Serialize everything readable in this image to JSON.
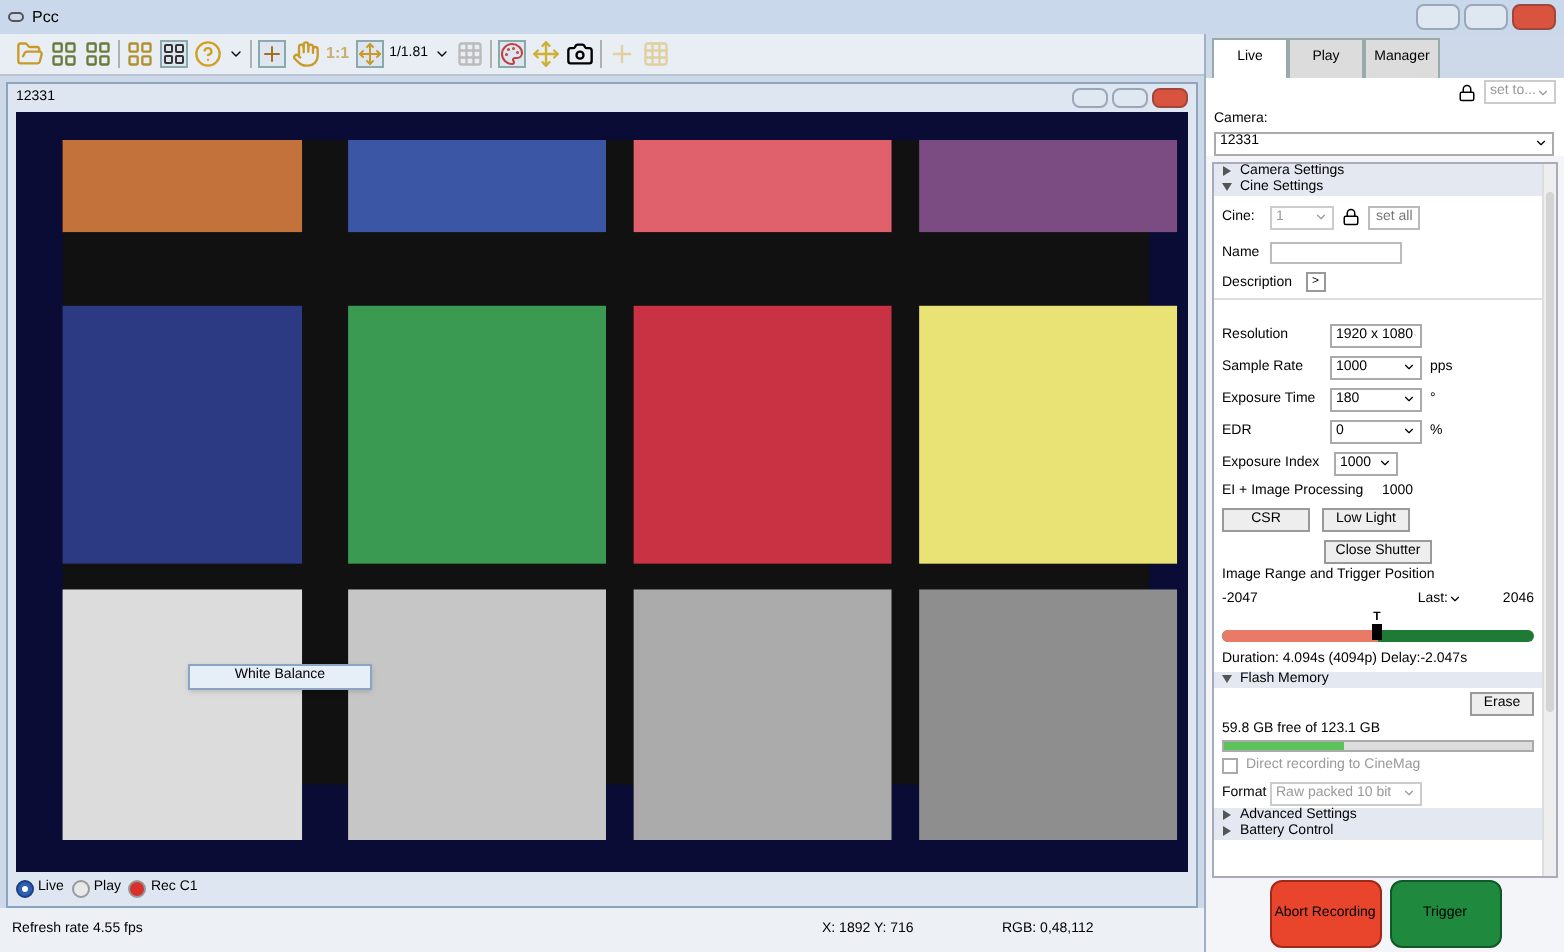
{
  "window": {
    "title": "Pcc"
  },
  "toolbar": {
    "actual_size": "1:1",
    "zoom": "1/1.81"
  },
  "viewer": {
    "title": "12331",
    "context_menu": {
      "item": "White Balance"
    },
    "modes": [
      {
        "label": "Live",
        "selected": true,
        "color": "#2f5fb0"
      },
      {
        "label": "Play",
        "selected": false,
        "color": "#e8e8e8"
      },
      {
        "label": "Rec C1",
        "selected": false,
        "color": "#d8302a"
      }
    ]
  },
  "status_bar": {
    "refresh": "Refresh rate 4.55 fps",
    "coords": "X: 1892 Y: 716",
    "rgb": "RGB: 0,48,112"
  },
  "panel": {
    "tabs": [
      {
        "label": "Live",
        "selected": true
      },
      {
        "label": "Play",
        "selected": false
      },
      {
        "label": "Manager",
        "selected": false
      }
    ],
    "camera_label": "Camera:",
    "camera": "12331",
    "set_to": "set to...",
    "camera_settings": {
      "title": "Camera Settings",
      "expanded": false
    },
    "cine_settings": {
      "title": "Cine Settings",
      "expanded": true,
      "cine_label": "Cine:",
      "cine": "1",
      "set_all": "set all",
      "name_label": "Name",
      "description_label": "Description",
      "description_button": ">",
      "fields": [
        {
          "label": "Resolution",
          "value": "1920 x 1080"
        },
        {
          "label": "Sample Rate",
          "value": "1000",
          "unit": "pps"
        },
        {
          "label": "Exposure Time",
          "value": "180",
          "unit": "°"
        },
        {
          "label": "EDR",
          "value": "0",
          "unit": "%"
        }
      ],
      "exposure_index_label": "Exposure Index",
      "exposure_index": "1000",
      "ei_label": "EI + Image Processing",
      "ei_value": "1000",
      "buttons": [
        "CSR",
        "Low Light"
      ],
      "close_shutter": "Close Shutter",
      "range_title": "Image Range and Trigger Position",
      "first": "-2047",
      "last_label": "Last:",
      "last": "2046",
      "trigger_mark": "T",
      "trigger": {
        "level": 0.5
      },
      "duration": "Duration: 4.094s (4094p) Delay:-2.047s"
    },
    "flash_memory": {
      "title": "Flash Memory",
      "expanded": true,
      "erase": "Erase",
      "free": "59.8 GB free of 123.1 GB",
      "usage": {
        "level": 0.39
      },
      "direct_recording": {
        "label": "Direct recording to CineMag",
        "checked": false,
        "disabled": true
      },
      "format_label": "Format",
      "format": "Raw packed 10 bit"
    },
    "advanced_settings": {
      "title": "Advanced Settings",
      "expanded": false
    },
    "battery_control": {
      "title": "Battery Control",
      "expanded": false
    },
    "abort": "Abort Recording",
    "trigger_button": "Trigger"
  }
}
